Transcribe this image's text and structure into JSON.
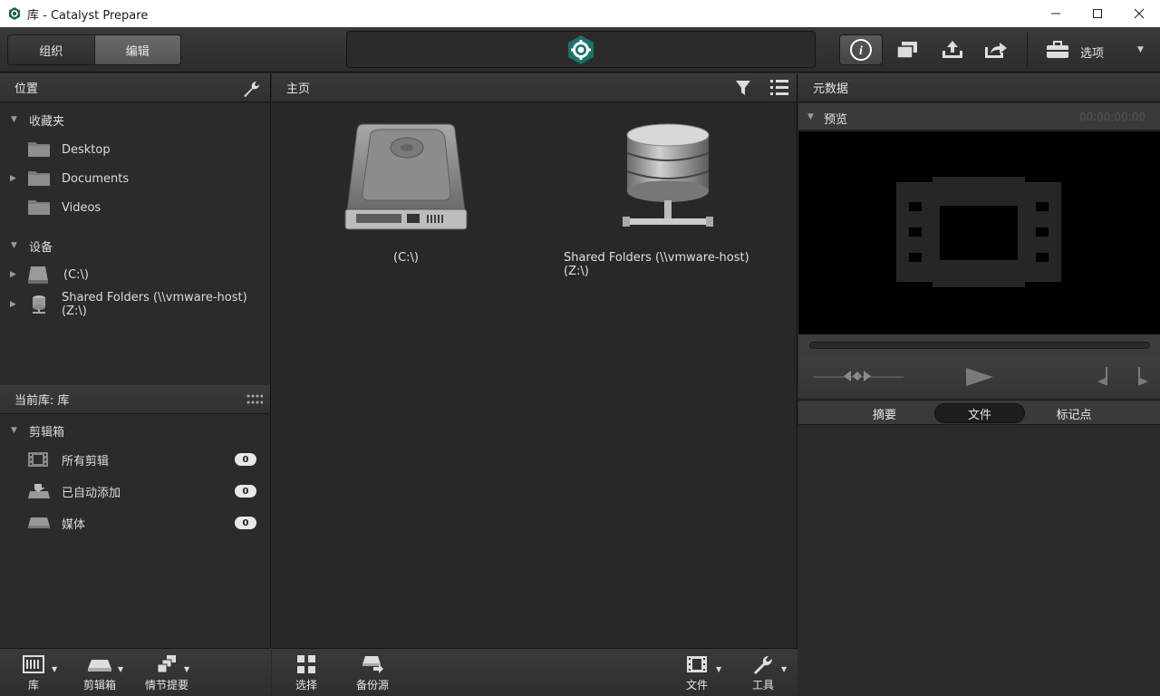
{
  "window": {
    "title": "库 - Catalyst Prepare",
    "controls": [
      "minimize-icon",
      "maximize-icon",
      "close-icon"
    ]
  },
  "toolbar": {
    "mode_tabs": [
      {
        "label": "组织",
        "active": false
      },
      {
        "label": "编辑",
        "active": true
      }
    ],
    "options_label": "选项"
  },
  "left": {
    "location_header": "位置",
    "favorites_label": "收藏夹",
    "favorites": [
      {
        "label": "Desktop"
      },
      {
        "label": "Documents"
      },
      {
        "label": "Videos"
      }
    ],
    "devices_label": "设备",
    "devices": [
      {
        "label": "(C:\\)"
      },
      {
        "label": "Shared Folders (\\\\vmware-host) (Z:\\)"
      }
    ],
    "current_library_header": "当前库: 库",
    "bins_label": "剪辑箱",
    "bins": [
      {
        "label": "所有剪辑",
        "count": "0"
      },
      {
        "label": "已自动添加",
        "count": "0"
      },
      {
        "label": "媒体",
        "count": "0"
      }
    ],
    "bottom": [
      {
        "label": "库"
      },
      {
        "label": "剪辑箱"
      },
      {
        "label": "情节提要"
      }
    ]
  },
  "center": {
    "header": "主页",
    "tiles": [
      {
        "label": "(C:\\)"
      },
      {
        "label": "Shared Folders (\\\\vmware-host) (Z:\\)"
      }
    ],
    "bottom": [
      {
        "label": "选择"
      },
      {
        "label": "备份源"
      },
      {
        "label": "文件"
      },
      {
        "label": "工具"
      }
    ]
  },
  "right": {
    "header": "元数据",
    "preview_label": "预览",
    "timecode": "00:00:00:00",
    "tabs": [
      {
        "label": "摘要",
        "active": false
      },
      {
        "label": "文件",
        "active": true
      },
      {
        "label": "标记点",
        "active": false
      }
    ]
  },
  "colors": {
    "accent_teal": "#1f6f6a",
    "panel_bg": "#2b2b2b",
    "header_bg": "#353535"
  }
}
